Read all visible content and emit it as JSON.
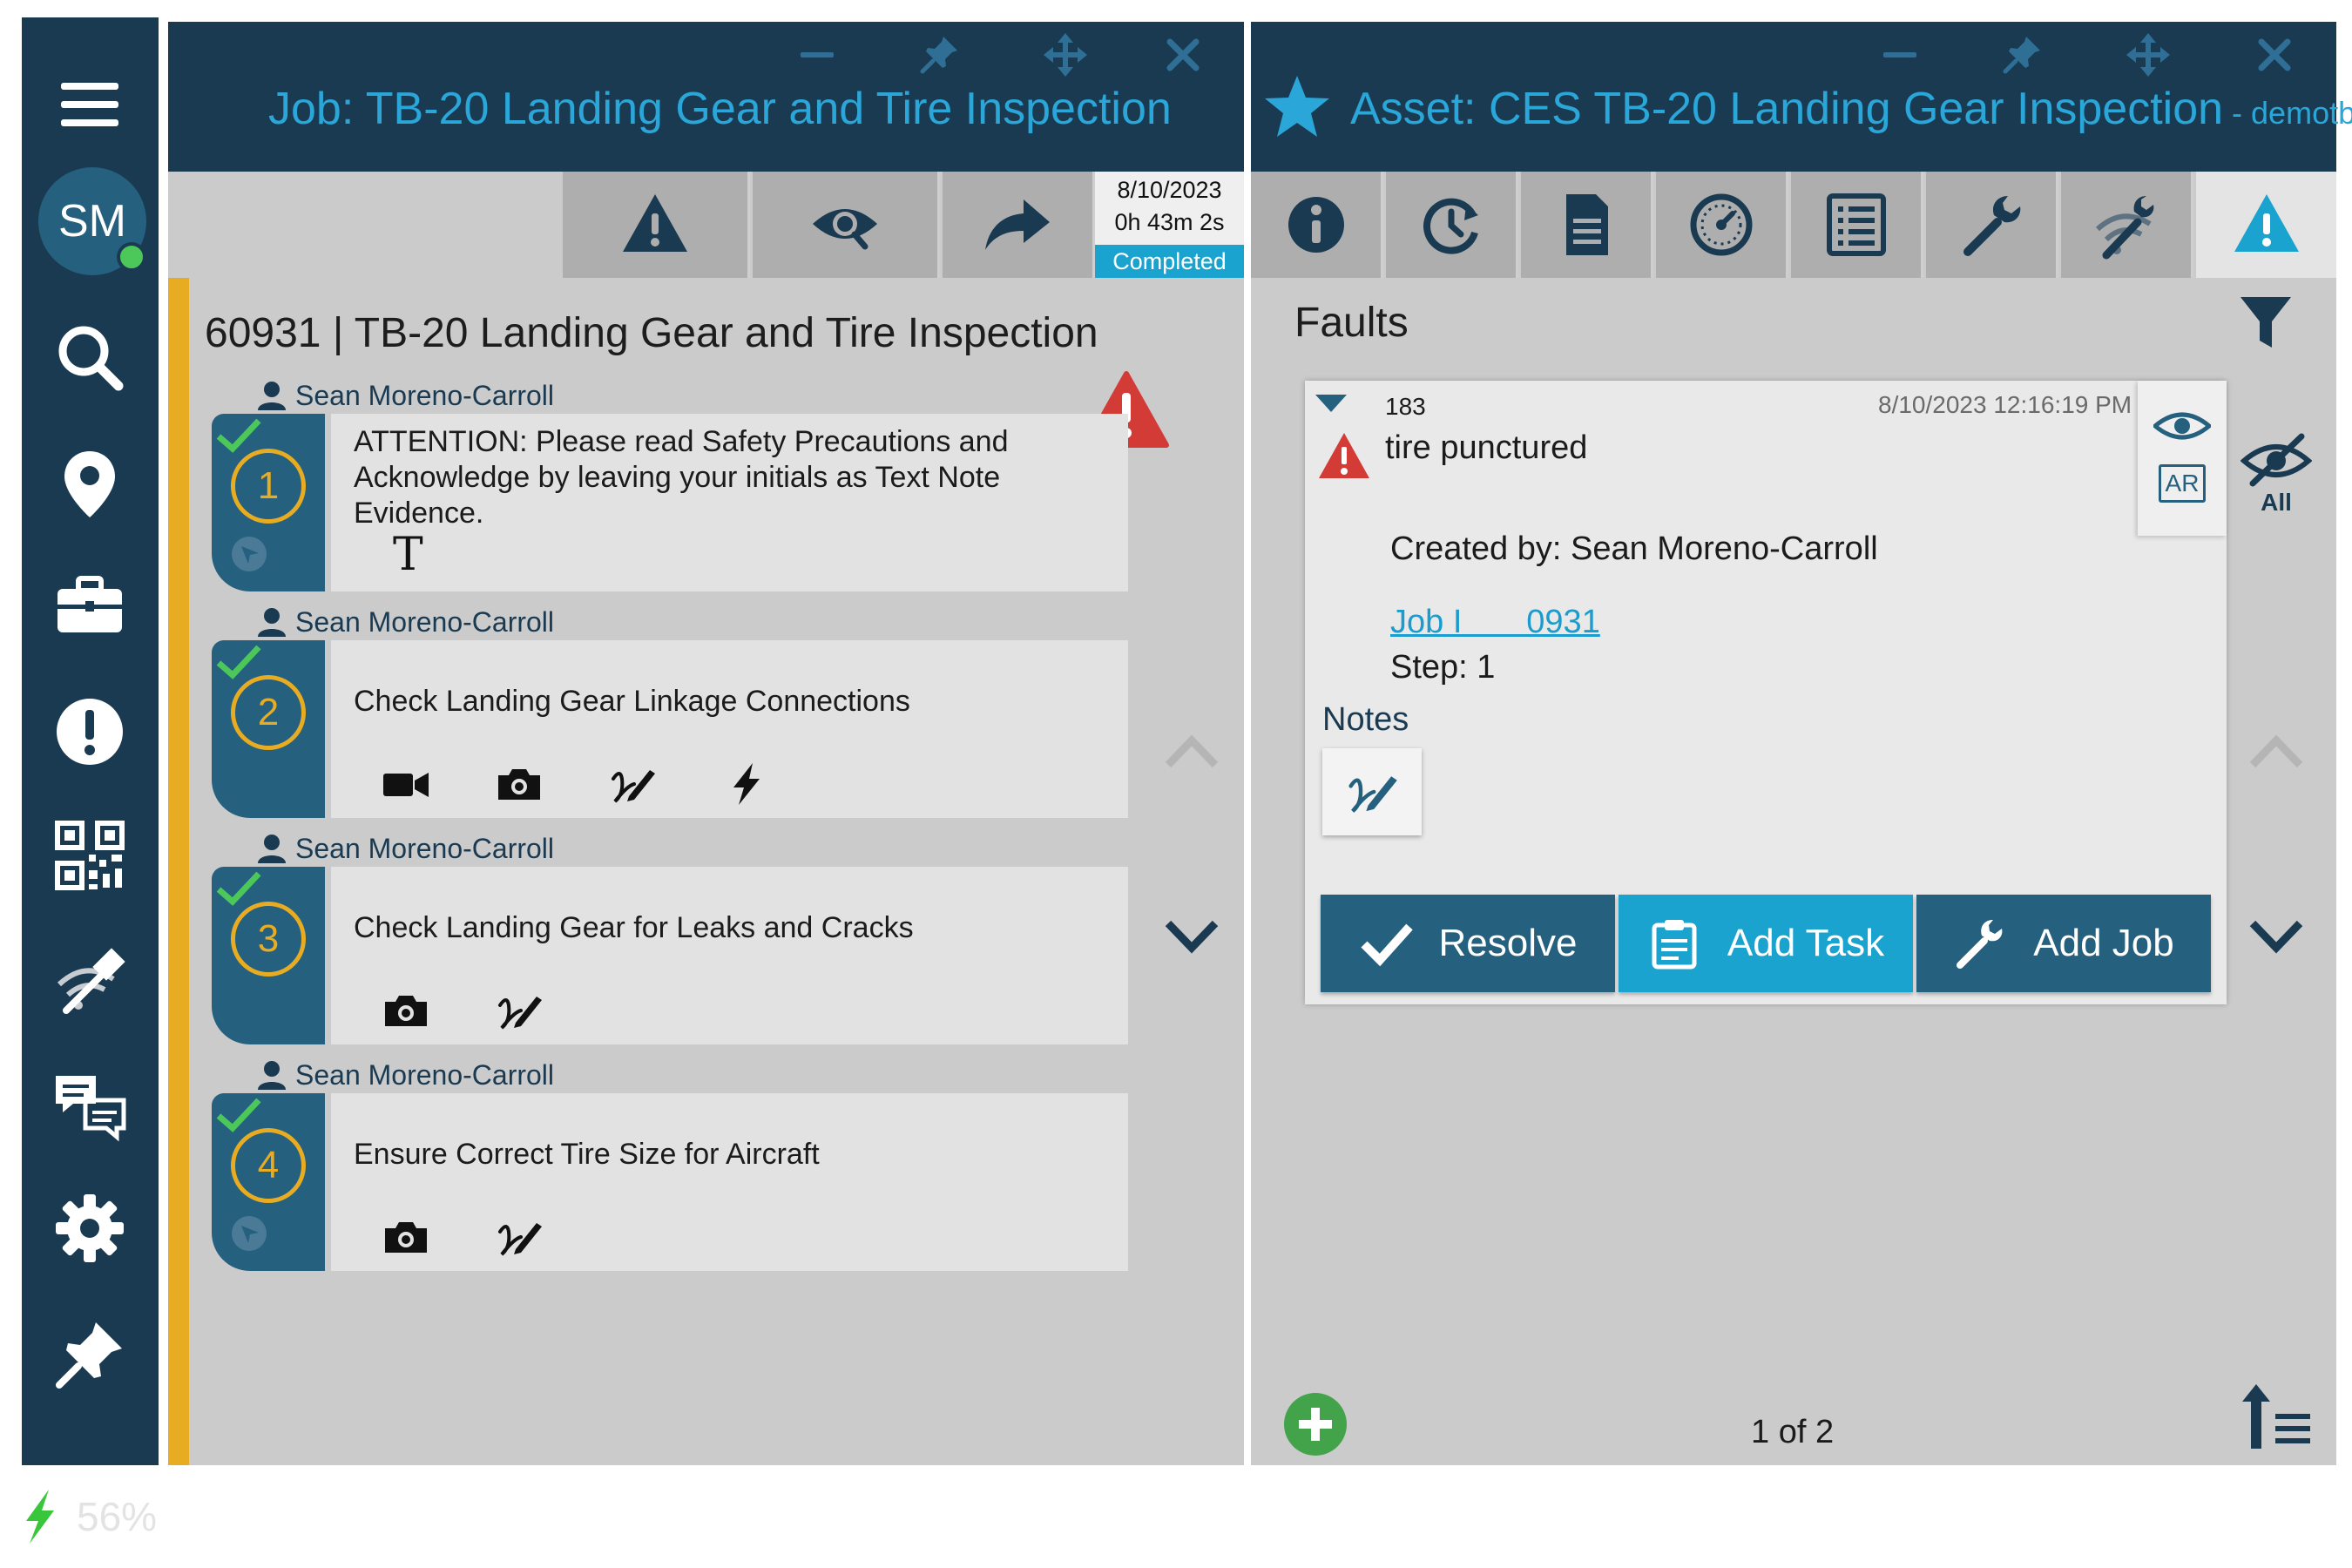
{
  "nav": {
    "avatar_initials": "SM",
    "items": [
      "menu-icon",
      "search-icon",
      "location-pin-icon",
      "briefcase-icon",
      "alert-icon",
      "qr-code-icon",
      "wireless-tool-icon",
      "chat-icon",
      "gear-icon",
      "pin-icon"
    ]
  },
  "job_panel": {
    "title": "Job: TB-20 Landing Gear and Tire Inspection",
    "status": {
      "date": "8/10/2023",
      "duration": "0h 43m 2s",
      "badge": "Completed"
    },
    "heading": "60931 | TB-20 Landing Gear and Tire Inspection",
    "steps": [
      {
        "number": "1",
        "owner": "Sean Moreno-Carroll",
        "text": "ATTENTION: Please read Safety Precautions and Acknowledge by leaving your initials as Text Note Evidence.",
        "evidence": [
          "text-note-icon"
        ]
      },
      {
        "number": "2",
        "owner": "Sean Moreno-Carroll",
        "text": "Check Landing Gear Linkage Connections",
        "evidence": [
          "video-icon",
          "camera-icon",
          "signature-icon",
          "flash-icon"
        ]
      },
      {
        "number": "3",
        "owner": "Sean Moreno-Carroll",
        "text": "Check Landing Gear for Leaks and Cracks",
        "evidence": [
          "camera-icon",
          "signature-icon"
        ]
      },
      {
        "number": "4",
        "owner": "Sean Moreno-Carroll",
        "text": "Ensure Correct Tire Size for Aircraft",
        "evidence": [
          "camera-icon",
          "signature-icon"
        ]
      }
    ]
  },
  "asset_panel": {
    "title": "Asset: CES TB-20 Landing Gear Inspection",
    "title_suffix": " - demotb",
    "section": "Faults",
    "fault": {
      "id": "183",
      "timestamp": "8/10/2023 12:16:19 PM",
      "title": "tire punctured",
      "created_by": "Created by: Sean Moreno-Carroll",
      "job_link": "Job I       0931",
      "step": "Step: 1",
      "notes_label": "Notes",
      "ar_label": "AR",
      "actions": {
        "resolve": "Resolve",
        "add_task": "Add Task",
        "add_job": "Add Job"
      }
    },
    "hide_all_label": "All",
    "pager": "1 of 2"
  },
  "battery": {
    "level": "56%"
  },
  "colors": {
    "nav": "#1a3a52",
    "accent": "#1ba3cf",
    "title": "#2aa6d8",
    "step_yellow": "#e8ac23",
    "warning_red": "#d23b36"
  }
}
